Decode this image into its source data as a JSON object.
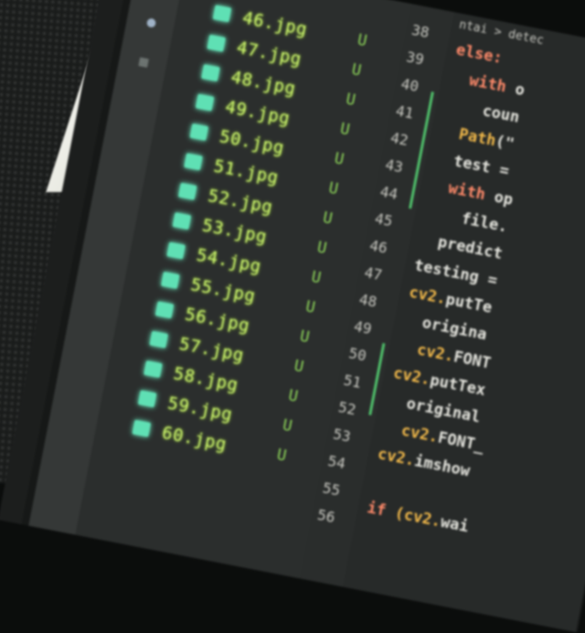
{
  "explorer": {
    "files": [
      {
        "name": "46.jpg",
        "status": "U"
      },
      {
        "name": "47.jpg",
        "status": "U"
      },
      {
        "name": "48.jpg",
        "status": "U"
      },
      {
        "name": "49.jpg",
        "status": "U"
      },
      {
        "name": "50.jpg",
        "status": "U"
      },
      {
        "name": "51.jpg",
        "status": "U"
      },
      {
        "name": "52.jpg",
        "status": "U"
      },
      {
        "name": "53.jpg",
        "status": "U"
      },
      {
        "name": "54.jpg",
        "status": "U"
      },
      {
        "name": "55.jpg",
        "status": "U"
      },
      {
        "name": "56.jpg",
        "status": "U"
      },
      {
        "name": "57.jpg",
        "status": "U"
      },
      {
        "name": "58.jpg",
        "status": "U"
      },
      {
        "name": "59.jpg",
        "status": "U"
      },
      {
        "name": "60.jpg",
        "status": "U"
      }
    ]
  },
  "editor": {
    "tab_label": "ntai > detec",
    "line_numbers": [
      "38",
      "39",
      "40",
      "41",
      "42",
      "43",
      "44",
      "45",
      "46",
      "47",
      "48",
      "49",
      "50",
      "51",
      "52",
      "53",
      "54",
      "55",
      "56"
    ],
    "code": [
      {
        "parts": [
          {
            "t": "else:",
            "c": "kw"
          }
        ]
      },
      {
        "parts": [
          {
            "t": "  with ",
            "c": "kw"
          },
          {
            "t": "o",
            "c": "tx"
          }
        ]
      },
      {
        "parts": [
          {
            "t": "    coun",
            "c": "tx"
          }
        ]
      },
      {
        "parts": [
          {
            "t": "  Path",
            "c": "fn"
          },
          {
            "t": "(\"",
            "c": "tx"
          }
        ]
      },
      {
        "parts": [
          {
            "t": "  test = ",
            "c": "tx"
          }
        ]
      },
      {
        "parts": [
          {
            "t": "  with ",
            "c": "kw"
          },
          {
            "t": "op",
            "c": "tx"
          }
        ]
      },
      {
        "parts": [
          {
            "t": "    file.",
            "c": "tx"
          }
        ]
      },
      {
        "parts": [
          {
            "t": "  predict",
            "c": "tx"
          }
        ]
      },
      {
        "parts": [
          {
            "t": "testing =",
            "c": "tx"
          }
        ]
      },
      {
        "parts": [
          {
            "t": "cv2.",
            "c": "fn"
          },
          {
            "t": "putTe",
            "c": "tx"
          }
        ]
      },
      {
        "parts": [
          {
            "t": "  origina",
            "c": "tx"
          }
        ]
      },
      {
        "parts": [
          {
            "t": "  cv2.",
            "c": "fn"
          },
          {
            "t": "FONT",
            "c": "tx"
          }
        ]
      },
      {
        "parts": [
          {
            "t": "cv2.",
            "c": "fn"
          },
          {
            "t": "putTex",
            "c": "tx"
          }
        ]
      },
      {
        "parts": [
          {
            "t": "  original",
            "c": "tx"
          }
        ]
      },
      {
        "parts": [
          {
            "t": "  cv2.",
            "c": "fn"
          },
          {
            "t": "FONT_",
            "c": "tx"
          }
        ]
      },
      {
        "parts": [
          {
            "t": "cv2.",
            "c": "fn"
          },
          {
            "t": "imshow",
            "c": "tx"
          }
        ]
      },
      {
        "parts": [
          {
            "t": "",
            "c": "tx"
          }
        ]
      },
      {
        "parts": [
          {
            "t": "if ",
            "c": "kw"
          },
          {
            "t": "(cv2.",
            "c": "fn"
          },
          {
            "t": "wai",
            "c": "tx"
          }
        ]
      }
    ]
  },
  "colors": {
    "file_icon": "#5fe0b4",
    "file_name": "#c8f06c",
    "keyword": "#ff8a6a",
    "function": "#f2b94a"
  }
}
